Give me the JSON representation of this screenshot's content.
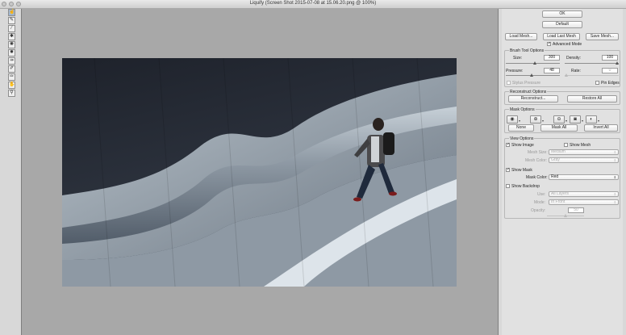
{
  "window": {
    "title": "Liquify (Screen Shot 2015-07-08 at 15.06.20.png @ 100%)"
  },
  "tools": [
    {
      "name": "forward-warp-tool",
      "glyph": "☝",
      "active": true
    },
    {
      "name": "reconstruct-tool",
      "glyph": "✎",
      "active": false
    },
    {
      "name": "smooth-tool",
      "glyph": "⁄",
      "active": false
    },
    {
      "name": "twirl-clockwise-tool",
      "glyph": "✱",
      "active": false
    },
    {
      "name": "pucker-tool",
      "glyph": "✺",
      "active": false
    },
    {
      "name": "bloat-tool",
      "glyph": "✹",
      "active": false
    },
    {
      "name": "push-left-tool",
      "glyph": "⇸",
      "active": false
    },
    {
      "name": "freeze-mask-tool",
      "glyph": "✐",
      "active": false
    },
    {
      "name": "thaw-mask-tool",
      "glyph": "✑",
      "active": false
    },
    {
      "name": "hand-tool",
      "glyph": "✋",
      "active": false
    },
    {
      "name": "zoom-tool",
      "glyph": "⚲",
      "active": false
    }
  ],
  "panel": {
    "ok": "OK",
    "default": "Default",
    "load_mesh": "Load Mesh...",
    "load_last_mesh": "Load Last Mesh",
    "save_mesh": "Save Mesh...",
    "advanced_mode": "Advanced Mode",
    "brush": {
      "title": "Brush Tool Options",
      "size_label": "Size:",
      "size": "300",
      "density_label": "Density:",
      "density": "100",
      "pressure_label": "Pressure:",
      "pressure": "48",
      "rate_label": "Rate:",
      "rate": "0",
      "stylus": "Stylus Pressure",
      "pin": "Pin Edges"
    },
    "reconstruct": {
      "title": "Reconstruct Options",
      "reconstruct": "Reconstruct...",
      "restore": "Restore All"
    },
    "mask": {
      "title": "Mask Options",
      "none": "None",
      "mask_all": "Mask All",
      "invert_all": "Invert All"
    },
    "view": {
      "title": "View Options",
      "show_image": "Show Image",
      "show_mesh": "Show Mesh",
      "mesh_size_label": "Mesh Size:",
      "mesh_size": "Medium",
      "mesh_color_label": "Mesh Color:",
      "mesh_color": "Gray",
      "show_mask": "Show Mask",
      "mask_color_label": "Mask Color:",
      "mask_color": "Red",
      "show_backdrop": "Show Backdrop",
      "use_label": "Use:",
      "use": "All Layers",
      "mode_label": "Mode:",
      "mode": "In Front",
      "opacity_label": "Opacity:",
      "opacity": "50"
    }
  }
}
